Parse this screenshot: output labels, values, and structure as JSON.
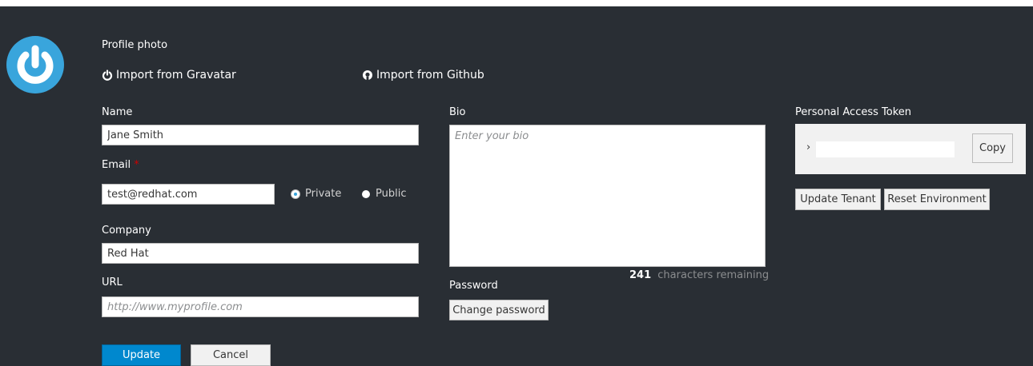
{
  "profile": {
    "photo_label": "Profile photo",
    "import_gravatar": "Import from Gravatar",
    "import_github": "Import from Github"
  },
  "form": {
    "name_label": "Name",
    "name_value": "Jane Smith",
    "email_label": "Email",
    "email_required_mark": "*",
    "email_value": "test@redhat.com",
    "visibility_private": "Private",
    "visibility_public": "Public",
    "visibility_selected": "Private",
    "company_label": "Company",
    "company_value": "Red Hat",
    "url_label": "URL",
    "url_placeholder": "http://www.myprofile.com",
    "bio_label": "Bio",
    "bio_placeholder": "Enter your bio",
    "chars_remaining_count": "241",
    "chars_remaining_text": "characters remaining",
    "password_label": "Password",
    "change_password": "Change password",
    "update_button": "Update",
    "cancel_button": "Cancel"
  },
  "token": {
    "label": "Personal Access Token",
    "expand_glyph": "›",
    "copy_button": "Copy",
    "update_tenant": "Update Tenant",
    "reset_environment": "Reset Environment"
  },
  "colors": {
    "background": "#292e34",
    "accent": "#0088ce",
    "avatar": "#39a5dc",
    "required": "#cc0000"
  },
  "icons": {
    "avatar": "power-icon",
    "gravatar": "power-icon",
    "github": "github-icon",
    "expand": "chevron-right-icon"
  }
}
